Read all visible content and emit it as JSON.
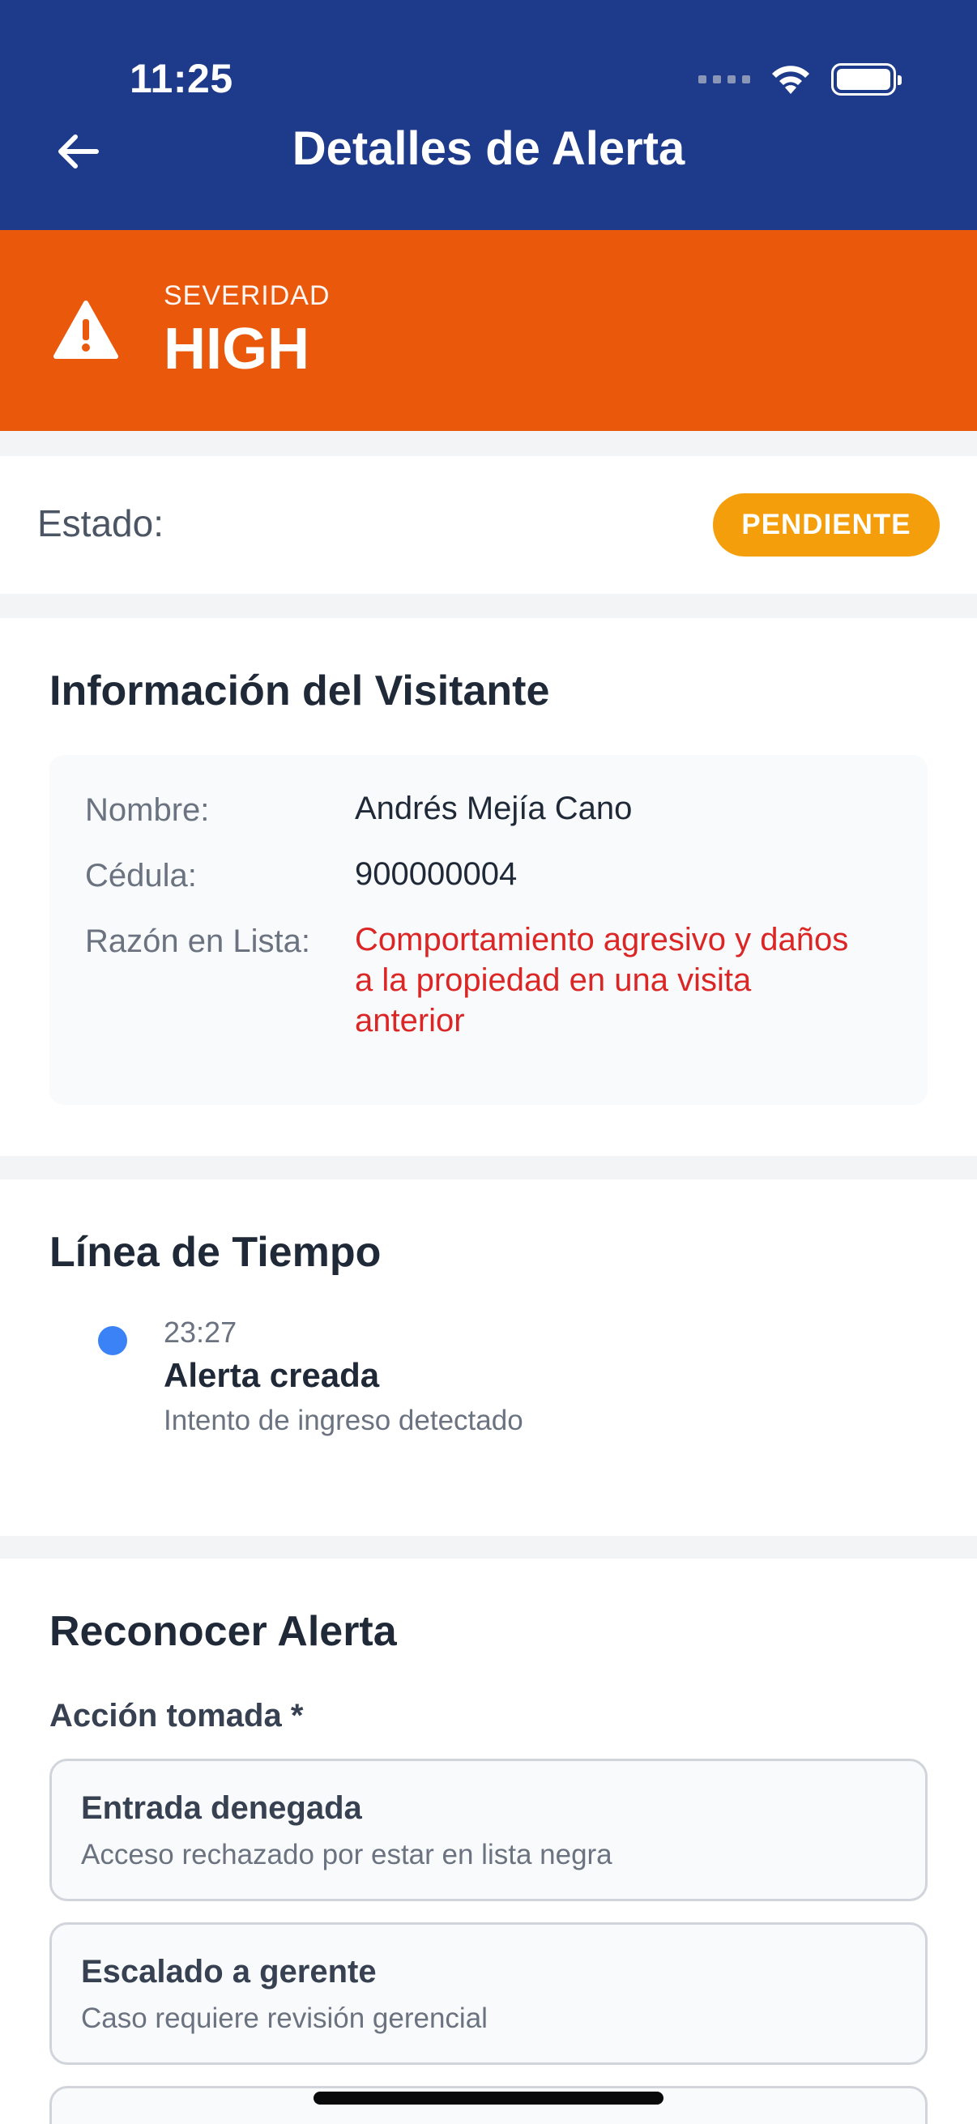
{
  "status_bar": {
    "time": "11:25"
  },
  "header": {
    "title": "Detalles de Alerta",
    "back_icon": "arrow-left-icon",
    "background_color": "#1e3a8a"
  },
  "severity": {
    "caption": "SEVERIDAD",
    "value": "HIGH",
    "icon": "warning-triangle-icon",
    "color": "#ea580c"
  },
  "status": {
    "label": "Estado:",
    "badge": "PENDIENTE",
    "badge_color": "#f59e0b"
  },
  "visitor": {
    "title": "Información del Visitante",
    "rows": [
      {
        "key": "Nombre:",
        "value": "Andrés Mejía Cano"
      },
      {
        "key": "Cédula:",
        "value": "900000004"
      },
      {
        "key": "Razón en Lista:",
        "value": "Comportamiento agresivo y daños a la propiedad en una visita anterior"
      }
    ]
  },
  "timeline": {
    "title": "Línea de Tiempo",
    "events": [
      {
        "time": "23:27",
        "title": "Alerta creada",
        "description": "Intento de ingreso detectado",
        "dot_color": "#3b82f6"
      }
    ]
  },
  "acknowledge": {
    "title": "Reconocer Alerta",
    "subtitle": "Acción tomada *",
    "options": [
      {
        "title": "Entrada denegada",
        "description": "Acceso rechazado por estar en lista negra"
      },
      {
        "title": "Escalado a gerente",
        "description": "Caso requiere revisión gerencial"
      }
    ]
  }
}
